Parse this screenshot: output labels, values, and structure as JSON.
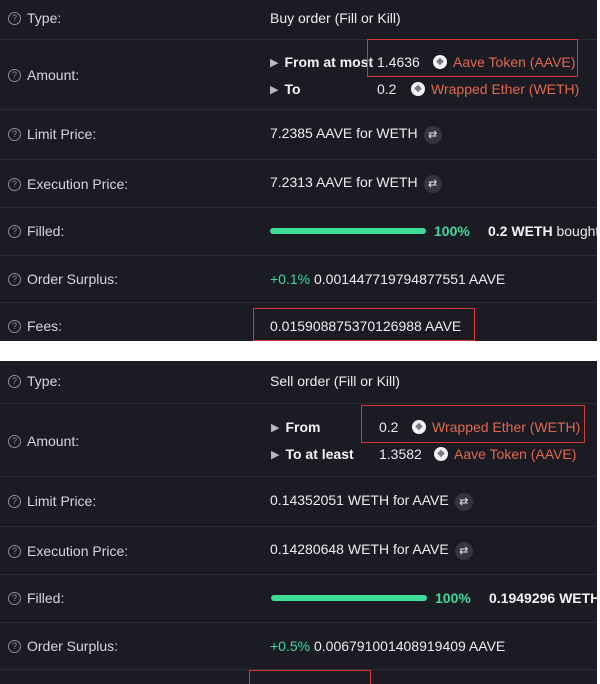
{
  "colors": {
    "background": "#1b1b23",
    "accent_green": "#3ddc97",
    "token_orange": "#e2684f",
    "highlight_red": "#d33a34"
  },
  "icons": {
    "help": "question-circle-icon",
    "token": "eth-diamond-icon",
    "swap": "swap-arrows-icon",
    "expand": "triangle-right-icon"
  },
  "order1": {
    "type_label": "Type:",
    "type_value": "Buy order (Fill or Kill)",
    "amount_label": "Amount:",
    "from_label": "From at most",
    "from_value": "1.4636",
    "from_token": "Aave Token (AAVE)",
    "to_label": "To",
    "to_value": "0.2",
    "to_token": "Wrapped Ether (WETH)",
    "limit_label": "Limit Price:",
    "limit_value": "7.2385 AAVE for WETH",
    "exec_label": "Execution Price:",
    "exec_value": "7.2313 AAVE for WETH",
    "filled_label": "Filled:",
    "filled_percent": "100%",
    "filled_fraction": 1.0,
    "filled_text": "0.2 WETH",
    "filled_suffix": "bought",
    "surplus_label": "Order Surplus:",
    "surplus_pct": "+0.1%",
    "surplus_value": "0.001447719794877551 AAVE",
    "fees_label": "Fees:",
    "fees_value": "0.015908875370126988 AAVE"
  },
  "order2": {
    "type_label": "Type:",
    "type_value": "Sell order (Fill or Kill)",
    "amount_label": "Amount:",
    "from_label": "From",
    "from_value": "0.2",
    "from_token": "Wrapped Ether (WETH)",
    "to_label": "To at least",
    "to_value": "1.3582",
    "to_token": "Aave Token (AAVE)",
    "limit_label": "Limit Price:",
    "limit_value": "0.14352051 WETH for AAVE",
    "exec_label": "Execution Price:",
    "exec_value": "0.14280648 WETH for AAVE",
    "filled_label": "Filled:",
    "filled_percent": "100%",
    "filled_fraction": 1.0,
    "filled_text": "0.1949296 WETH",
    "surplus_label": "Order Surplus:",
    "surplus_pct": "+0.5%",
    "surplus_value": "0.006791001408919409 AAVE"
  }
}
